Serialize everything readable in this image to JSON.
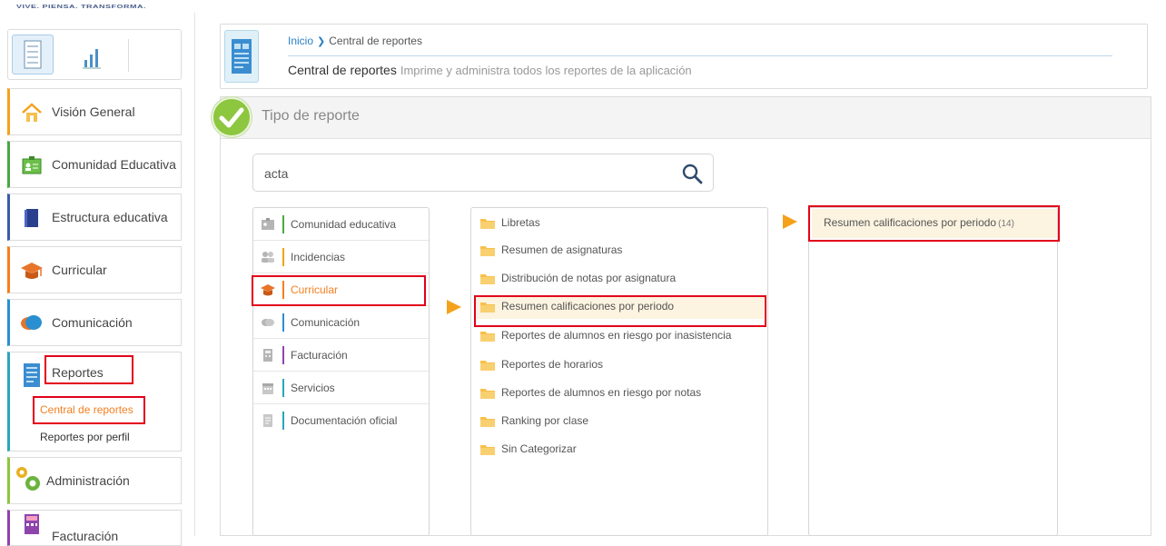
{
  "sidebar": {
    "top_clip_text": "VIVE. PIENSA. TRANSFORMA.",
    "view_switch": {
      "list_icon": "list-view-icon",
      "chart_icon": "bar-chart-icon"
    },
    "items": [
      {
        "label": "Visión General",
        "icon": "home-icon",
        "accent": "#f5a21b"
      },
      {
        "label": "Comunidad Educativa",
        "icon": "id-card-icon",
        "accent": "#49a942"
      },
      {
        "label": "Estructura educativa",
        "icon": "book-icon",
        "accent": "#3b5ba9"
      },
      {
        "label": "Curricular",
        "icon": "graduation-cap-icon",
        "accent": "#f57f20"
      },
      {
        "label": "Comunicación",
        "icon": "chat-bubbles-icon",
        "accent": "#2a8fd0"
      },
      {
        "label": "Reportes",
        "icon": "report-document-icon",
        "accent": "#2aa6b8"
      },
      {
        "label": "Administración",
        "icon": "gears-icon",
        "accent": "#8dc63f"
      },
      {
        "label": "Facturación",
        "icon": "calculator-icon",
        "accent": "#8e44ad"
      }
    ],
    "reportes_sub": [
      {
        "label": "Central de reportes",
        "active": true
      },
      {
        "label": "Reportes por perfil",
        "active": false
      }
    ]
  },
  "header": {
    "breadcrumb": {
      "home": "Inicio",
      "current": "Central de reportes"
    },
    "title": "Central de reportes",
    "subtitle": "Imprime y administra todos los reportes de la aplicación"
  },
  "panel": {
    "title": "Tipo de reporte",
    "search": {
      "value": "acta",
      "placeholder": ""
    }
  },
  "categories": [
    {
      "label": "Comunidad educativa",
      "icon": "id-card-icon",
      "bar": "#49a942"
    },
    {
      "label": "Incidencias",
      "icon": "people-icon",
      "bar": "#f5a21b"
    },
    {
      "label": "Curricular",
      "icon": "graduation-cap-icon",
      "bar": "#f57f20"
    },
    {
      "label": "Comunicación",
      "icon": "chat-bubbles-icon",
      "bar": "#2a8fd0"
    },
    {
      "label": "Facturación",
      "icon": "calculator-icon",
      "bar": "#8e44ad"
    },
    {
      "label": "Servicios",
      "icon": "calendar-icon",
      "bar": "#2aa6b8"
    },
    {
      "label": "Documentación oficial",
      "icon": "document-icon",
      "bar": "#2aa6b8"
    }
  ],
  "report_groups": [
    {
      "label": "Libretas"
    },
    {
      "label": "Resumen de asignaturas"
    },
    {
      "label": "Distribución de notas por asignatura"
    },
    {
      "label": "Resumen calificaciones por periodo"
    },
    {
      "label": "Reportes de alumnos en riesgo por inasistencia"
    },
    {
      "label": "Reportes de horarios"
    },
    {
      "label": "Reportes de alumnos en riesgo por notas"
    },
    {
      "label": "Ranking por clase"
    },
    {
      "label": "Sin Categorizar"
    }
  ],
  "results": [
    {
      "label": "Resumen calificaciones por periodo",
      "count": "(14)"
    }
  ],
  "colors": {
    "accent_orange": "#f5a21b",
    "highlight_red": "#e2001a",
    "link_blue": "#2a7fc2",
    "selected_bg": "#fcf3e0"
  }
}
